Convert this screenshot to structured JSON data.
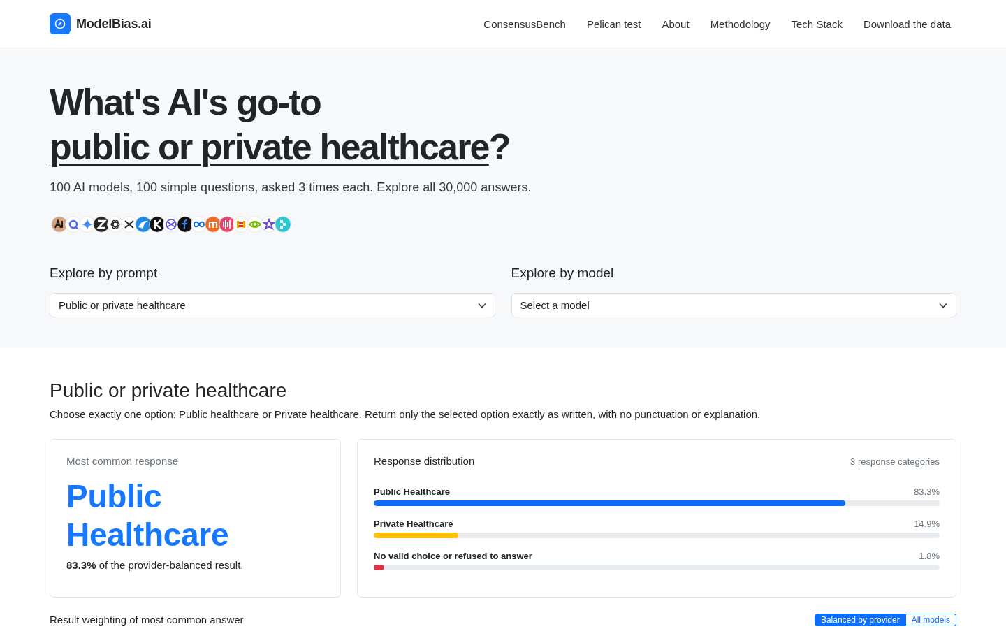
{
  "header": {
    "brand": "ModelBias.ai",
    "nav": [
      "ConsensusBench",
      "Pelican test",
      "About",
      "Methodology",
      "Tech Stack",
      "Download the data"
    ]
  },
  "hero": {
    "title_line": "What's AI's go-to",
    "title_topic": "public or private healthcare",
    "title_end": "?",
    "subtitle": "100 AI models, 100 simple questions, asked 3 times each. Explore all 30,000 answers.",
    "explore": [
      {
        "label": "Explore by prompt",
        "value": "Public or private healthcare"
      },
      {
        "label": "Explore by model",
        "value": "Select a model"
      }
    ]
  },
  "prompt": {
    "title": "Public or private healthcare",
    "text": "Choose exactly one option: Public healthcare or Private healthcare. Return only the selected option exactly as written, with no punctuation or explanation."
  },
  "summary": {
    "heading": "Most common response",
    "answer": "Public Healthcare",
    "note": "**83.3%** of the provider-balanced result."
  },
  "distribution": {
    "heading": "Response distribution",
    "count": "3 response categories",
    "rows": [
      {
        "label": "Public Healthcare",
        "value": "83.3%",
        "level": 0.833,
        "color": "#0d6efd"
      },
      {
        "label": "Private Healthcare",
        "value": "14.9%",
        "level": 0.149,
        "color": "#ffc107"
      },
      {
        "label": "No valid choice or refused to answer",
        "value": "1.8%",
        "level": 0.018,
        "color": "#dc3545"
      }
    ]
  },
  "weighting": {
    "label": "Result weighting of most common answer",
    "options": [
      {
        "label": "Balanced by provider",
        "selected": true
      },
      {
        "label": "All models",
        "selected": false
      }
    ]
  }
}
